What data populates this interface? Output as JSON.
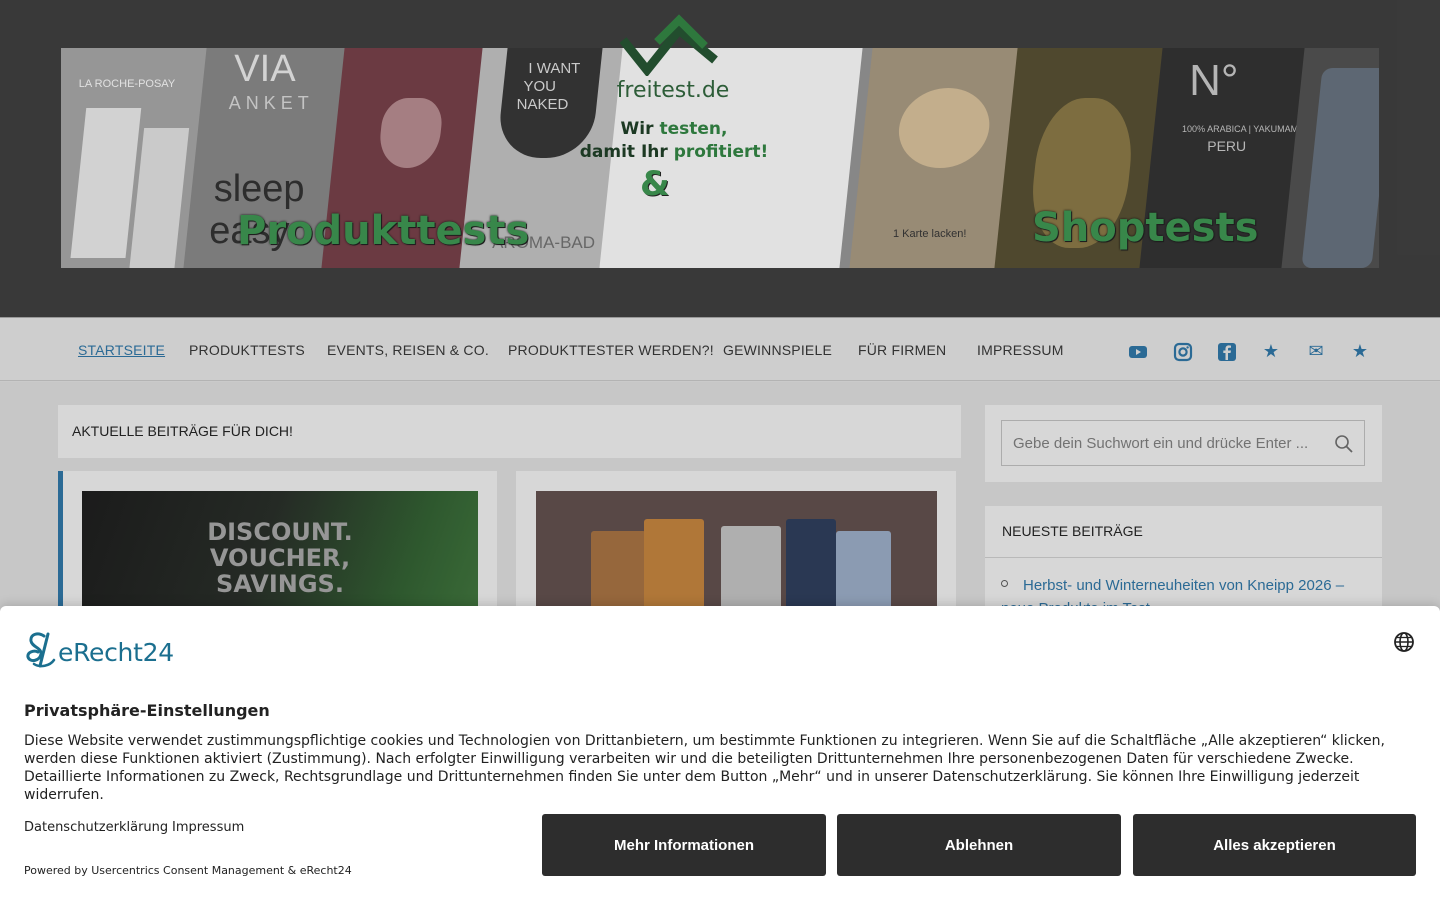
{
  "banner": {
    "left_word": "Produkttests",
    "right_word": "Shoptests",
    "logo_text": "freitest.de",
    "tagline_line1_a": "Wir ",
    "tagline_line1_b": "testen,",
    "tagline_line2_a": "damit Ihr ",
    "tagline_line2_b": "profitiert!",
    "amp": "&"
  },
  "nav": {
    "items": [
      {
        "label": "STARTSEITE",
        "active": true
      },
      {
        "label": "PRODUKTTESTS"
      },
      {
        "label": "EVENTS, REISEN & CO."
      },
      {
        "label": "PRODUKTTESTER WERDEN?!"
      },
      {
        "label": "GEWINNSPIELE"
      },
      {
        "label": "FÜR FIRMEN"
      },
      {
        "label": "IMPRESSUM"
      }
    ],
    "social_icons": [
      "youtube-icon",
      "instagram-icon",
      "facebook-icon",
      "star-icon",
      "mail-icon",
      "star-icon"
    ],
    "star_glyph": "★",
    "mail_glyph": "✉"
  },
  "main": {
    "section_title": "AKTUELLE BEITRÄGE FÜR DICH!",
    "card1_image_text": [
      "DISCOUNT.",
      "VOUCHER,",
      "SAVINGS."
    ]
  },
  "sidebar": {
    "search_placeholder": "Gebe dein Suchwort ein und drücke Enter ...",
    "recent_title": "NEUESTE BEITRÄGE",
    "recent_items": [
      "Herbst- und Winterneuheiten von Kneipp 2026 – neue Produkte im Test"
    ]
  },
  "consent": {
    "brand": "eRecht24",
    "title": "Privatsphäre-Einstellungen",
    "body": "Diese Website verwendet zustimmungspflichtige cookies und Technologien von Drittanbietern, um bestimmte Funktionen zu integrieren. Wenn Sie auf die Schaltfläche „Alle akzeptieren“ klicken, werden diese Funktionen aktiviert (Zustimmung). Nach erfolgter Einwilligung verarbeiten wir und die beteiligten Drittunternehmen Ihre personenbezogenen Daten für verschiedene Zwecke. Detaillierte Informationen zu Zweck, Rechtsgrundlage und Drittunternehmen finden Sie unter dem Button „Mehr“ und in unserer Datenschutzerklärung. Sie können Ihre Einwilligung jederzeit widerrufen.",
    "link_privacy": "Datenschutzerklärung",
    "link_imprint": "Impressum",
    "powered": "Powered by Usercentrics Consent Management & eRecht24",
    "btn_more": "Mehr Informationen",
    "btn_deny": "Ablehnen",
    "btn_accept": "Alles akzeptieren"
  },
  "colors": {
    "accent": "#2c6d98",
    "banner_green": "#3a8a4c",
    "button_dark": "#2d2d2d",
    "brand_teal": "#1b6f8f"
  }
}
